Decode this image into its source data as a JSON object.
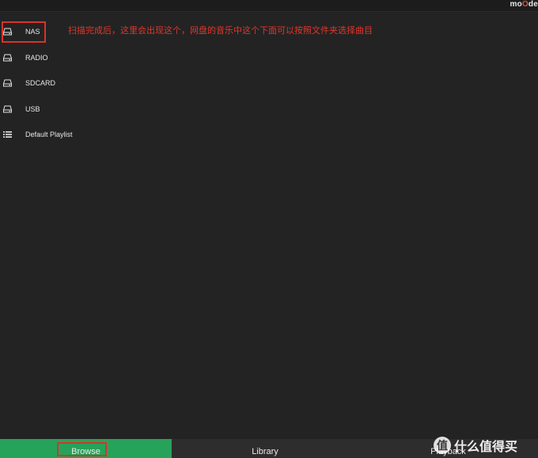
{
  "header": {
    "logo_prefix": "mo",
    "logo_accent": "O",
    "logo_suffix": "de"
  },
  "sources": [
    {
      "label": "NAS",
      "icon": "drive-icon"
    },
    {
      "label": "RADIO",
      "icon": "drive-icon"
    },
    {
      "label": "SDCARD",
      "icon": "drive-icon"
    },
    {
      "label": "USB",
      "icon": "drive-icon"
    },
    {
      "label": "Default Playlist",
      "icon": "list-icon"
    }
  ],
  "annotation": {
    "text": "扫描完成后，这里会出现这个，网盘的音乐中这个下面可以按照文件夹选择曲目"
  },
  "tabs": {
    "browse": "Browse",
    "library": "Library",
    "playback": "Playback"
  },
  "watermark": {
    "symbol": "值",
    "text": "什么值得买"
  },
  "colors": {
    "background": "#232323",
    "active_tab": "#27a25a",
    "inactive_tab": "#2d2d2d",
    "highlight": "#d8332a",
    "logo_accent": "#d8533a"
  }
}
